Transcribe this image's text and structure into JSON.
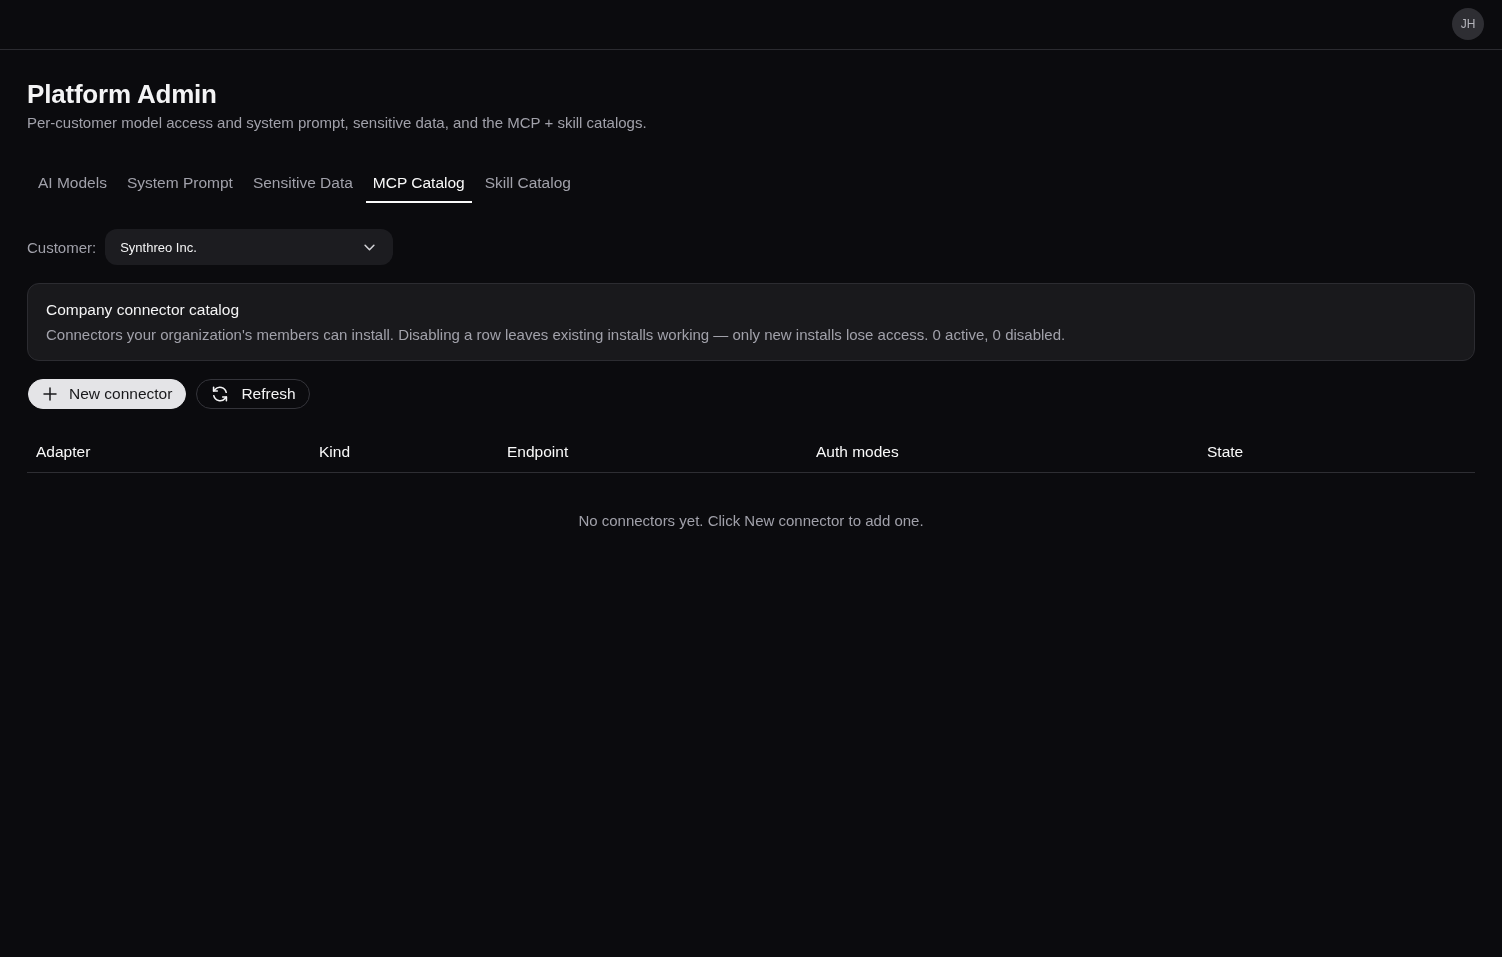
{
  "header": {
    "avatar_initials": "JH"
  },
  "page": {
    "title": "Platform Admin",
    "subtitle": "Per-customer model access and system prompt, sensitive data, and the MCP + skill catalogs."
  },
  "tabs": [
    {
      "label": "AI Models",
      "selected": false
    },
    {
      "label": "System Prompt",
      "selected": false
    },
    {
      "label": "Sensitive Data",
      "selected": false
    },
    {
      "label": "MCP Catalog",
      "selected": true
    },
    {
      "label": "Skill Catalog",
      "selected": false
    }
  ],
  "customer_filter": {
    "label": "Customer:",
    "value": "Synthreo Inc."
  },
  "info_card": {
    "title": "Company connector catalog",
    "description": "Connectors your organization's members can install. Disabling a row leaves existing installs working — only new installs lose access. 0 active, 0 disabled."
  },
  "toolbar": {
    "buttons": [
      {
        "label": "New connector",
        "kind": "add"
      },
      {
        "label": "Refresh",
        "kind": "refresh"
      }
    ]
  },
  "table": {
    "columns": [
      "Adapter",
      "Kind",
      "Endpoint",
      "Auth modes",
      "State"
    ],
    "empty_message": "No connectors yet. Click New connector to add one."
  }
}
